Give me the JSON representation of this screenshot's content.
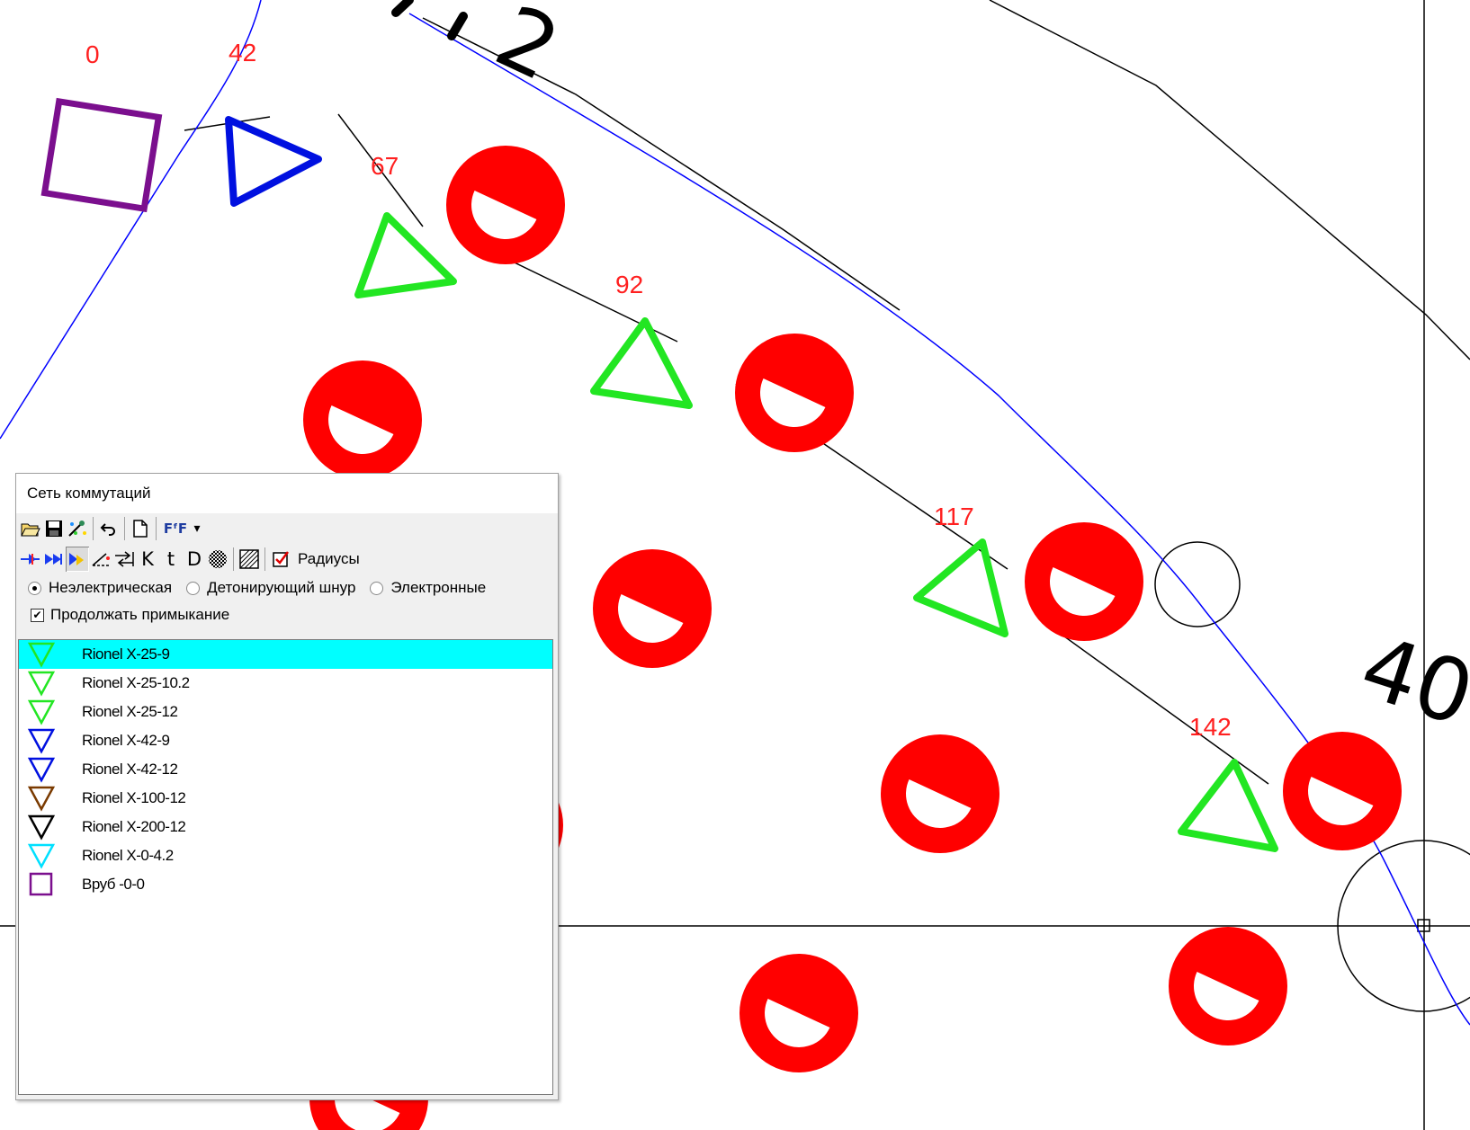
{
  "drawing": {
    "delay_labels": [
      "0",
      "42",
      "67",
      "92",
      "117",
      "142"
    ],
    "big_labels": [
      "2",
      "40"
    ],
    "colors": {
      "hole": "#ff0000",
      "blue_line": "#0000ff",
      "purple": "#7b0f8e",
      "green": "#22e622",
      "blue_det": "#0010e0",
      "delay_text": "#ff2020"
    }
  },
  "panel": {
    "title": "Сеть коммутаций",
    "toolbar1": {
      "icons": [
        "open-folder-icon",
        "save-icon",
        "magic-icon",
        "undo-icon",
        "new-page-icon",
        "font-icon",
        "dropdown-arrow-icon"
      ],
      "font_glyph": "FᶠF",
      "dropdown_glyph": "▾"
    },
    "toolbar2": {
      "k_label": "K",
      "t_label": "t",
      "d_label": "D",
      "radius_label": "Радиусы"
    },
    "options": {
      "nonelectric": "Неэлектрическая",
      "detcord": "Детонирующий шнур",
      "electronic": "Электронные",
      "selected": "nonelectric"
    },
    "continue_label": "Продолжать примыкание",
    "continue_checked": true,
    "detonators": [
      {
        "label": "Rionel X-25-9",
        "color": "#22e622",
        "shape": "triangle",
        "selected": true
      },
      {
        "label": "Rionel X-25-10.2",
        "color": "#22e622",
        "shape": "triangle"
      },
      {
        "label": "Rionel X-25-12",
        "color": "#22e622",
        "shape": "triangle"
      },
      {
        "label": "Rionel X-42-9",
        "color": "#0010e0",
        "shape": "triangle"
      },
      {
        "label": "Rionel X-42-12",
        "color": "#0010e0",
        "shape": "triangle"
      },
      {
        "label": "Rionel X-100-12",
        "color": "#7a3a00",
        "shape": "triangle"
      },
      {
        "label": "Rionel X-200-12",
        "color": "#000000",
        "shape": "triangle"
      },
      {
        "label": "Rionel X-0-4.2",
        "color": "#00e0ff",
        "shape": "triangle"
      },
      {
        "label": "Вруб -0-0",
        "color": "#7b0f8e",
        "shape": "square"
      }
    ]
  }
}
